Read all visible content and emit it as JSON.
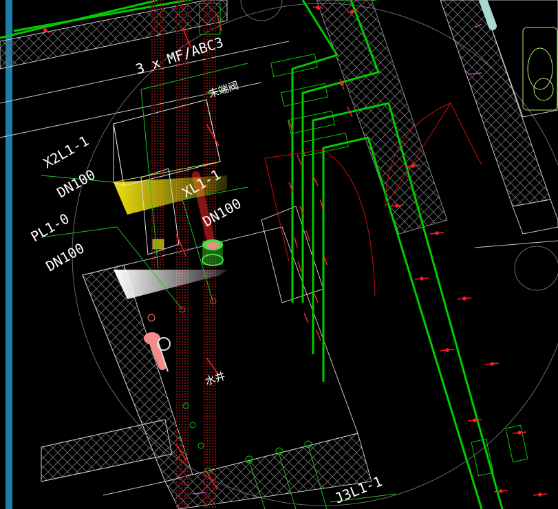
{
  "labels": {
    "extinguisher": "3 x MF/ABC3",
    "valve": "末端阀",
    "x2l1": "X2L1-1",
    "dn100_a": "DN100",
    "pl1": "PL1-0",
    "dn100_b": "DN100",
    "xl1": "XL1-1",
    "dn100_c": "DN100",
    "shaft": "水井",
    "j3l1": "J3L1-1"
  },
  "colors": {
    "background": "#000000",
    "pipe_green": "#00cc00",
    "wall_white": "#c8c8c8",
    "leader_green": "#22c022",
    "tick_red": "#ff2020",
    "riser_red": "#6a0b0b",
    "yellow": "#f0e010",
    "blue_column": "#1e7ea8",
    "pink": "#f48a8a"
  }
}
